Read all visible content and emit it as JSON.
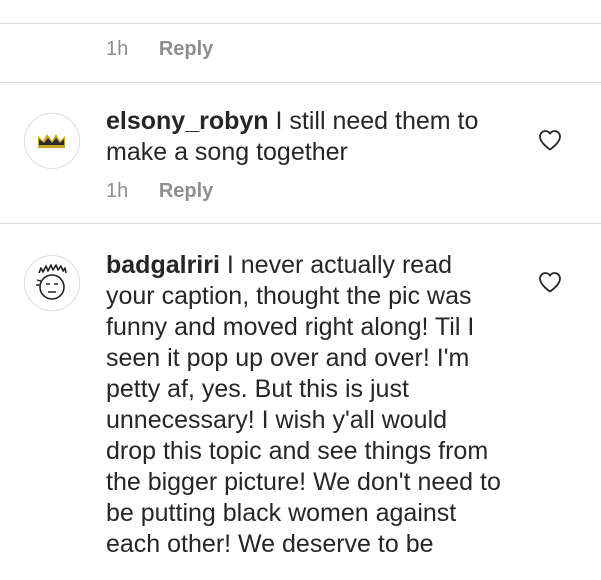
{
  "previous_comment": {
    "time": "1h",
    "reply_label": "Reply"
  },
  "comments": [
    {
      "username": "elsony_robyn",
      "text": "I still need them to make a song together",
      "time": "1h",
      "reply_label": "Reply",
      "avatar_icon": "crown-icon"
    },
    {
      "username": "badgalriri",
      "text": "I never actually read your caption, thought the pic was funny and moved right along! Til I seen it pop up over and over! I'm petty af, yes. But this is just unnecessary! I wish y'all would drop this topic and see things from the bigger picture! We don't need to be putting black women against each other! We deserve to be",
      "avatar_icon": "doodle-face-icon"
    }
  ],
  "icons": {
    "like": "heart-outline-icon"
  },
  "colors": {
    "text": "#262626",
    "muted": "#8e8e8e",
    "divider": "#dcdcdc",
    "crown": "#c9a227"
  }
}
